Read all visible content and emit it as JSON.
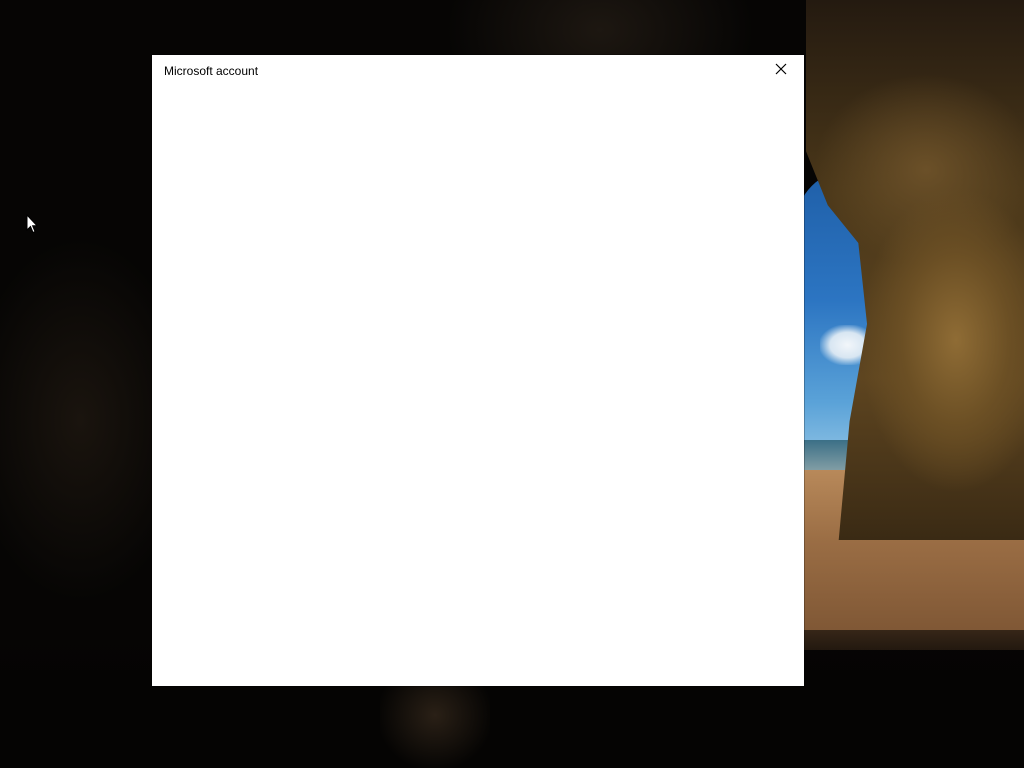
{
  "dialog": {
    "title": "Microsoft account",
    "close_icon": "close-icon"
  },
  "wallpaper": {
    "description_icon": "lock-screen-wallpaper"
  },
  "cursor": {
    "icon": "arrow-cursor-icon"
  },
  "colors": {
    "dialog_background": "#ffffff",
    "title_text": "#000000",
    "close_hover": "#e81123"
  }
}
